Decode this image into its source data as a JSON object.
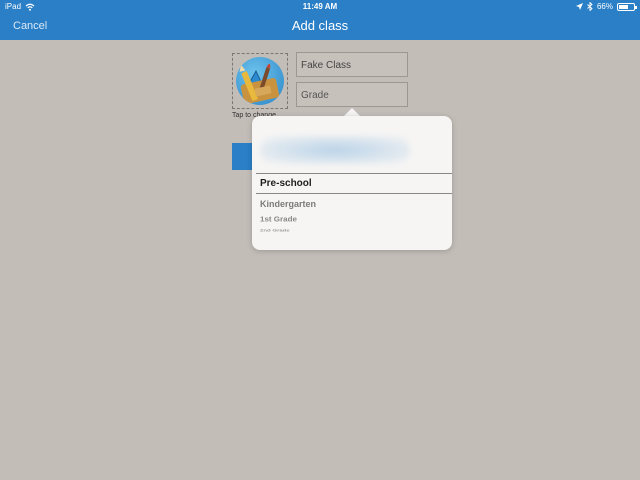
{
  "status_bar": {
    "device": "iPad",
    "time": "11:49 AM",
    "battery": "66%",
    "battery_level": 0.66
  },
  "nav_bar": {
    "cancel_label": "Cancel",
    "title": "Add class"
  },
  "form": {
    "photo_caption": "Tap to change",
    "class_name_value": "Fake Class",
    "grade_placeholder": "Grade"
  },
  "grade_picker": {
    "selected": "Pre-school",
    "options_below": [
      "Kindergarten",
      "1st Grade",
      "2nd Grade"
    ]
  },
  "colors": {
    "accent": "#2a7fc6",
    "background": "#c3bdb8",
    "popover": "#f6f5f4"
  },
  "icons": {
    "wifi": "wifi-icon",
    "location": "location-arrow-icon",
    "bluetooth": "bluetooth-icon",
    "battery": "battery-icon",
    "class_photo": "art-supplies-icon"
  }
}
